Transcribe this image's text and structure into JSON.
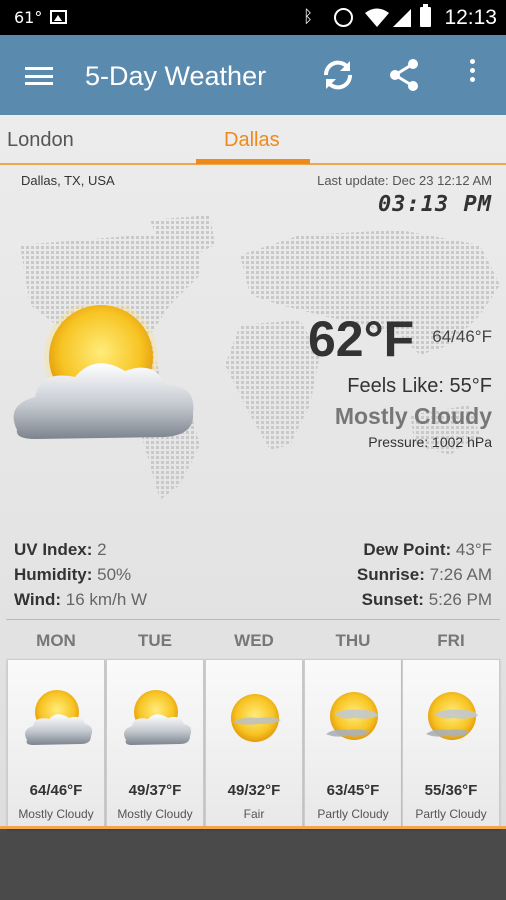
{
  "status_bar": {
    "temperature": "61°",
    "time": "12:13"
  },
  "app_bar": {
    "title": "5-Day Weather",
    "color": "#5b8aaf",
    "icons": [
      "menu-icon",
      "refresh-icon",
      "share-icon",
      "overflow-icon"
    ]
  },
  "tabs": [
    {
      "label": "London",
      "selected": false
    },
    {
      "label": "Dallas",
      "selected": true
    }
  ],
  "accent": "#ee8a1a",
  "current": {
    "location": "Dallas, TX, USA",
    "last_update": "Last update: Dec 23  12:12 AM",
    "local_time": "03:13 PM",
    "temperature": "62°F",
    "high_low": "64/46°F",
    "feels_like": "Feels Like: 55°F",
    "condition": "Mostly Cloudy",
    "pressure": "Pressure: 1002 hPa",
    "icon": "partly-cloudy-icon"
  },
  "details": {
    "uv_label": "UV Index:",
    "uv_value": "2",
    "humidity_label": "Humidity:",
    "humidity_value": "50%",
    "wind_label": "Wind:",
    "wind_value": "16 km/h W",
    "dew_label": "Dew Point:",
    "dew_value": "43°F",
    "sunrise_label": "Sunrise:",
    "sunrise_value": "7:26 AM",
    "sunset_label": "Sunset:",
    "sunset_value": "5:26 PM"
  },
  "forecast": [
    {
      "day": "MON",
      "temp": "64/46°F",
      "condition": "Mostly Cloudy",
      "icon": "mostly-cloudy-icon"
    },
    {
      "day": "TUE",
      "temp": "49/37°F",
      "condition": "Mostly Cloudy",
      "icon": "mostly-cloudy-icon"
    },
    {
      "day": "WED",
      "temp": "49/32°F",
      "condition": "Fair",
      "icon": "fair-icon"
    },
    {
      "day": "THU",
      "temp": "63/45°F",
      "condition": "Partly Cloudy",
      "icon": "partly-cloudy-icon"
    },
    {
      "day": "FRI",
      "temp": "55/36°F",
      "condition": "Partly Cloudy",
      "icon": "partly-cloudy-icon"
    }
  ]
}
